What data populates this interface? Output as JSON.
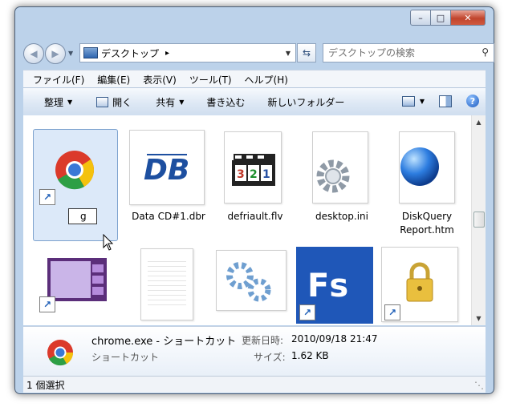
{
  "window": {
    "caption_buttons": [
      "minimize",
      "maximize",
      "close"
    ]
  },
  "nav": {
    "back_icon": "back-arrow-icon",
    "forward_icon": "forward-arrow-icon",
    "address": {
      "location": "デスクトップ",
      "separator": "▸"
    },
    "search_placeholder": "デスクトップの検索"
  },
  "menu": [
    "ファイル(F)",
    "編集(E)",
    "表示(V)",
    "ツール(T)",
    "ヘルプ(H)"
  ],
  "commands": {
    "organize": "整理",
    "open": "開く",
    "share": "共有",
    "burn": "書き込む",
    "new_folder": "新しいフォルダー"
  },
  "files": {
    "row1": [
      {
        "label": "",
        "icon": "chrome-icon",
        "shortcut": true,
        "rename_value": "g"
      },
      {
        "label": "Data CD#1.dbr",
        "icon": "db-logo-icon"
      },
      {
        "label": "defriault.flv",
        "icon": "video-clapper-icon"
      },
      {
        "label": "desktop.ini",
        "icon": "gear-file-icon"
      },
      {
        "label": "DiskQuery Report.htm",
        "icon": "web-page-icon"
      }
    ],
    "row2_icons": [
      "video-app-icon",
      "text-file-icon",
      "settings-window-icon",
      "fs-app-icon",
      "lock-icon"
    ]
  },
  "details": {
    "name": "chrome.exe - ショートカット",
    "type": "ショートカット",
    "modified_label": "更新日時:",
    "modified_value": "2010/09/18 21:47",
    "size_label": "サイズ:",
    "size_value": "1.62 KB"
  },
  "status": {
    "text": "1 個選択"
  }
}
